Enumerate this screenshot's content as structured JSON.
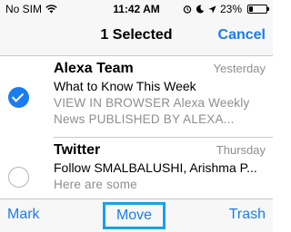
{
  "status_bar": {
    "carrier": "No SIM",
    "time": "11:42 AM",
    "battery_percent": "23%",
    "battery_level": 0.23
  },
  "nav": {
    "title": "1 Selected",
    "cancel_label": "Cancel"
  },
  "messages": [
    {
      "sender": "Alexa Team",
      "time": "Yesterday",
      "subject": "What to Know This Week",
      "preview_line1": "VIEW IN BROWSER Alexa Weekly",
      "preview_line2": "News PUBLISHED BY ALEXA...",
      "selected": true
    },
    {
      "sender": "Twitter",
      "time": "Thursday",
      "subject": "Follow SMALBALUSHI, Arishma P...",
      "preview_line1": "Here are some",
      "selected": false
    }
  ],
  "toolbar": {
    "mark_label": "Mark",
    "move_label": "Move",
    "trash_label": "Trash"
  },
  "colors": {
    "accent": "#1a7cf0",
    "highlight_box": "#1aa0e6",
    "secondary_text": "#8e8e93"
  }
}
